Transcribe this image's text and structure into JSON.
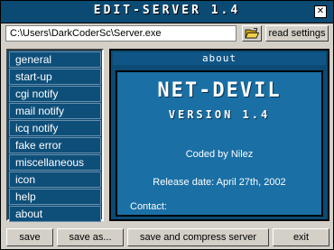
{
  "window": {
    "title": "EDIT-SERVER 1.4",
    "close_glyph": "✕"
  },
  "toolbar": {
    "path_value": "C:\\Users\\DarkCoderSc\\Server.exe",
    "browse_icon": "open-folder-icon",
    "read_label": "read settings"
  },
  "menu": {
    "items": [
      {
        "label": "general"
      },
      {
        "label": "start-up"
      },
      {
        "label": "cgi notify"
      },
      {
        "label": "mail notify"
      },
      {
        "label": "icq notify"
      },
      {
        "label": "fake error"
      },
      {
        "label": "miscellaneous"
      },
      {
        "label": "icon"
      },
      {
        "label": "help"
      },
      {
        "label": "about"
      }
    ]
  },
  "panel": {
    "header": "about",
    "title": "NET-DEVIL",
    "version": "VERSION 1.4",
    "coded_by": "Coded by Nilez",
    "release": "Release date: April 27th, 2002",
    "contact": "Contact:"
  },
  "buttons": {
    "save": "save",
    "save_as": "save as...",
    "save_compress": "save and compress server",
    "exit": "exit"
  },
  "colors": {
    "accent": "#0b4a73",
    "panel_body": "#1a6fa5",
    "face": "#d4d0c8"
  }
}
